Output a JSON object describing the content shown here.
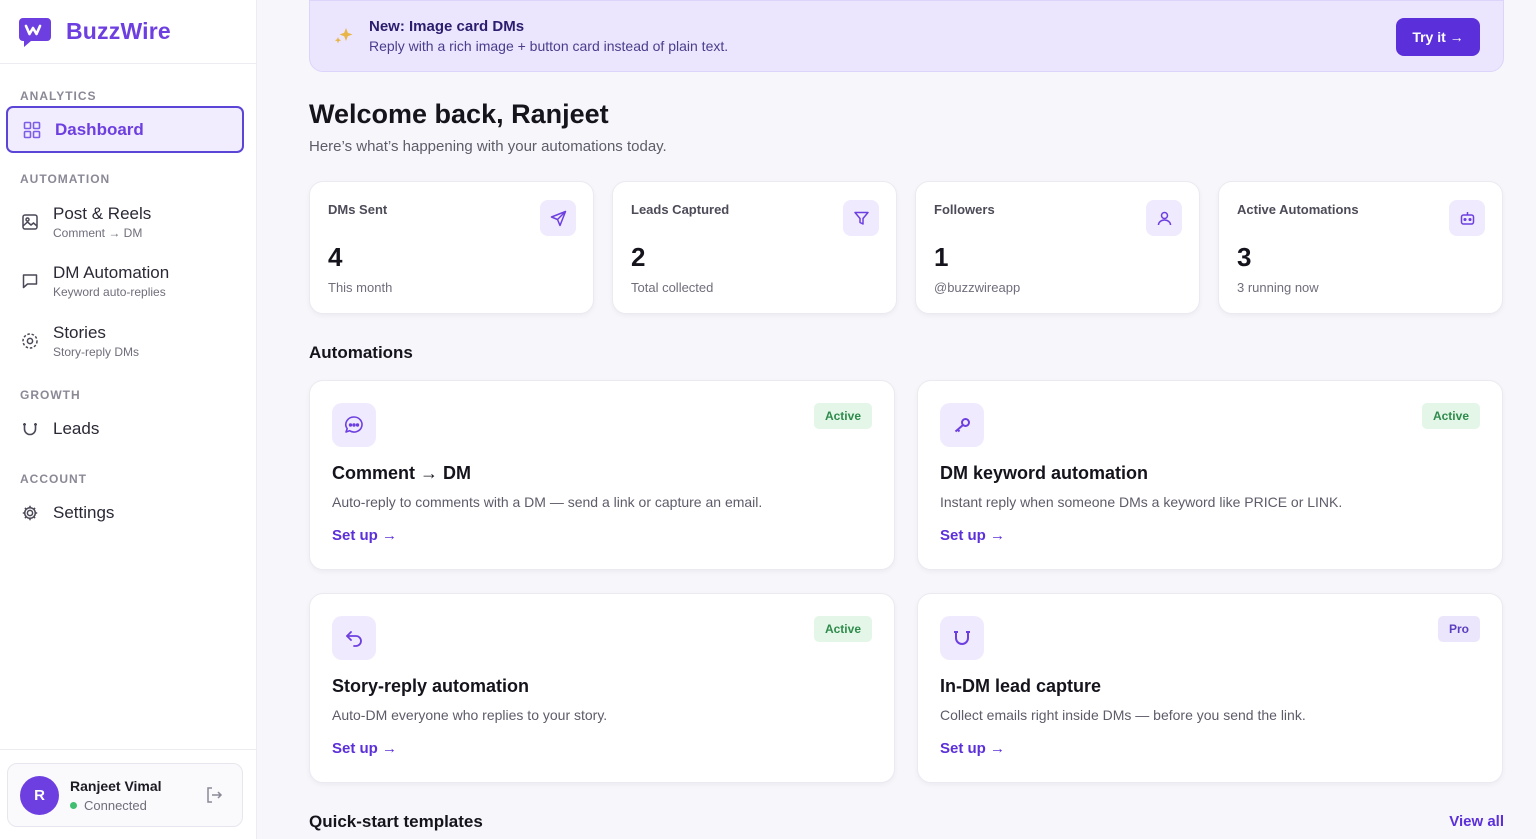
{
  "brand": {
    "name": "BuzzWire"
  },
  "sidebar": {
    "sections": {
      "analytics": "ANALYTICS",
      "automation": "AUTOMATION",
      "growth": "GROWTH",
      "account": "ACCOUNT"
    },
    "items": [
      {
        "label": "Dashboard",
        "sub": ""
      },
      {
        "label": "Post & Reels",
        "sub": "Comment → DM"
      },
      {
        "label": "DM Automation",
        "sub": "Keyword auto-replies"
      },
      {
        "label": "Stories",
        "sub": "Story-reply DMs"
      },
      {
        "label": "Leads",
        "sub": ""
      },
      {
        "label": "Settings",
        "sub": ""
      }
    ],
    "user": {
      "initial": "R",
      "name": "Ranjeet Vimal",
      "status": "Connected"
    }
  },
  "banner": {
    "title": "New: Image card DMs",
    "subtitle": "Reply with a rich image + button card instead of plain text.",
    "button": "Try it →"
  },
  "welcome": {
    "title": "Welcome back, Ranjeet",
    "subtitle": "Here’s what’s happening with your automations today."
  },
  "stats": [
    {
      "label": "DMs Sent",
      "value": "4",
      "sub": "This month",
      "icon": "send-icon"
    },
    {
      "label": "Leads Captured",
      "value": "2",
      "sub": "Total collected",
      "icon": "filter-icon"
    },
    {
      "label": "Followers",
      "value": "1",
      "sub": "@buzzwireapp",
      "icon": "user-icon"
    },
    {
      "label": "Active Automations",
      "value": "3",
      "sub": "3 running now",
      "icon": "bot-icon"
    }
  ],
  "automations": {
    "heading": "Automations",
    "cards": [
      {
        "title": "Comment → DM",
        "desc": "Auto-reply to comments with a DM — send a link or capture an email.",
        "badge": "Active",
        "link": "Set up →"
      },
      {
        "title": "DM keyword automation",
        "desc": "Instant reply when someone DMs a keyword like PRICE or LINK.",
        "badge": "Active",
        "link": "Set up →"
      },
      {
        "title": "Story-reply automation",
        "desc": "Auto-DM everyone who replies to your story.",
        "badge": "Active",
        "link": "Set up →"
      },
      {
        "title": "In-DM lead capture",
        "desc": "Collect emails right inside DMs — before you send the link.",
        "badge": "Pro",
        "link": "Set up →"
      }
    ]
  },
  "templates": {
    "heading": "Quick-start templates",
    "view_all": "View all"
  },
  "colors": {
    "accent": "#6d3fe0",
    "button": "#5b2fd9",
    "active_badge": "#2f8b4b",
    "status_dot": "#3fbf6f"
  }
}
